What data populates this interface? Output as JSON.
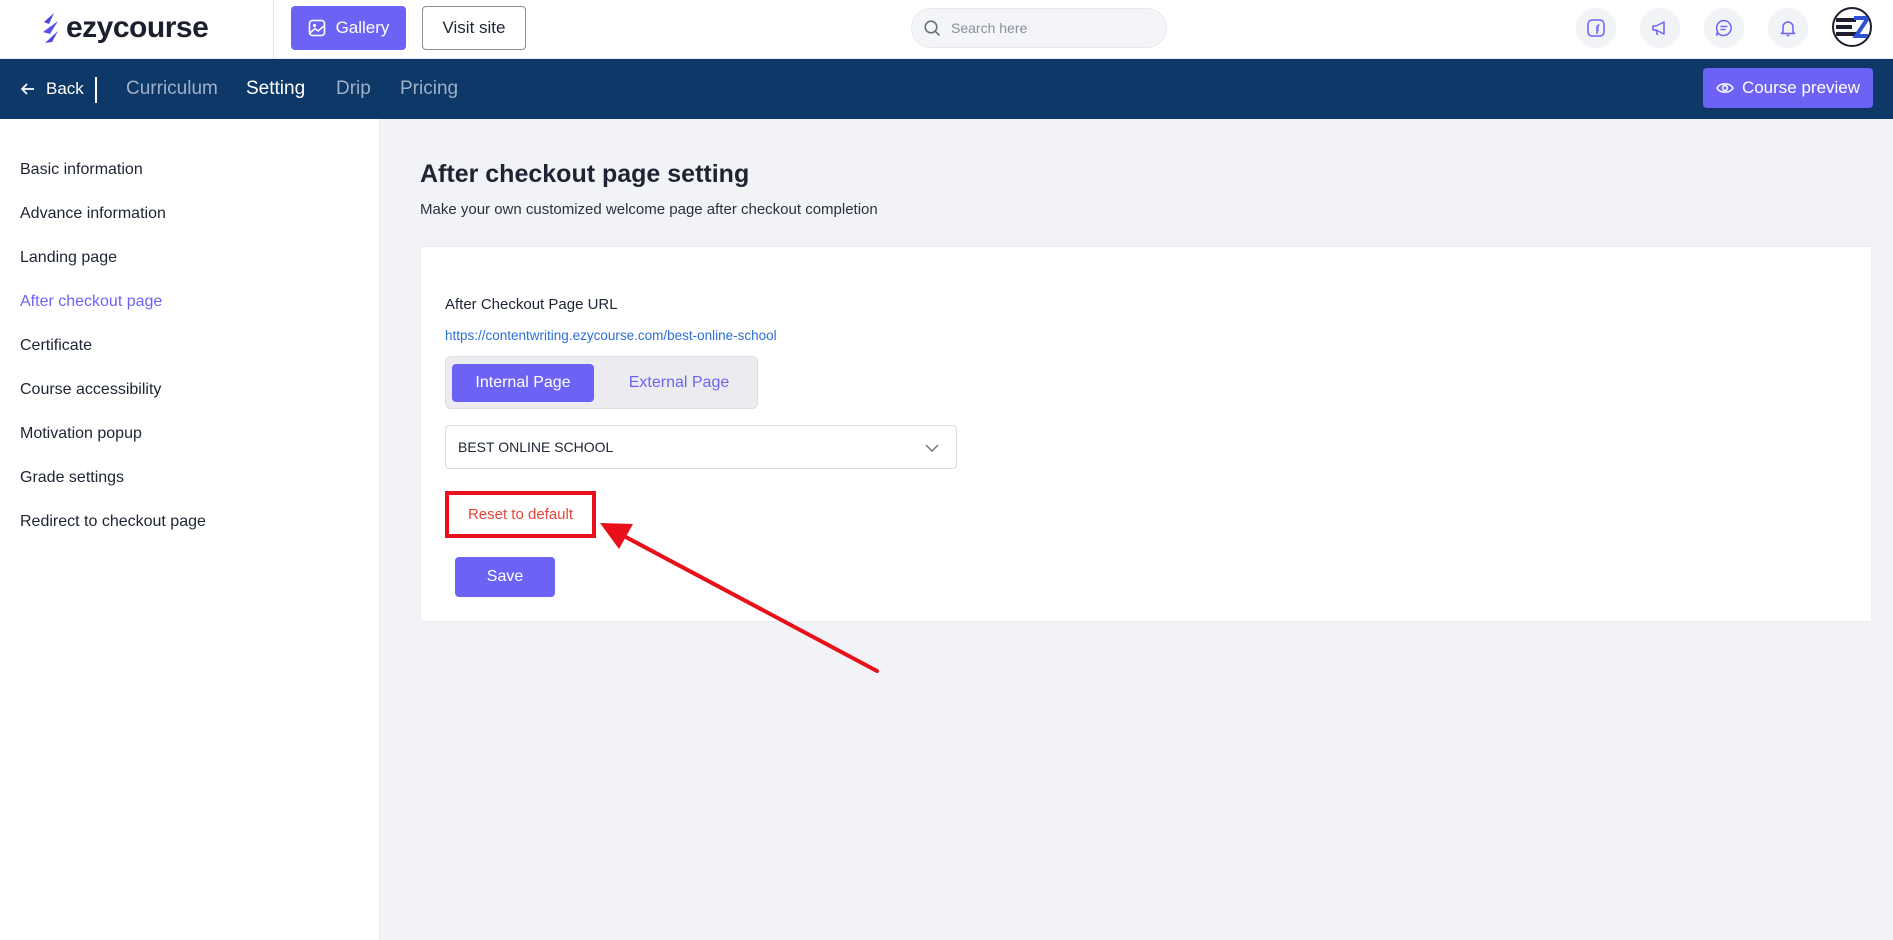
{
  "brand": {
    "name": "ezycourse"
  },
  "topbar": {
    "gallery_label": "Gallery",
    "visit_label": "Visit site",
    "search_placeholder": "Search here",
    "icons": [
      "facebook-icon",
      "megaphone-icon",
      "chat-icon",
      "bell-icon"
    ]
  },
  "nav": {
    "back_label": "Back",
    "tabs": [
      {
        "label": "Curriculum",
        "active": false
      },
      {
        "label": "Setting",
        "active": true
      },
      {
        "label": "Drip",
        "active": false
      },
      {
        "label": "Pricing",
        "active": false
      }
    ],
    "preview_label": "Course preview"
  },
  "sidebar": {
    "items": [
      {
        "label": "Basic information",
        "active": false
      },
      {
        "label": "Advance information",
        "active": false
      },
      {
        "label": "Landing page",
        "active": false
      },
      {
        "label": "After checkout page",
        "active": true
      },
      {
        "label": "Certificate",
        "active": false
      },
      {
        "label": "Course accessibility",
        "active": false
      },
      {
        "label": "Motivation popup",
        "active": false
      },
      {
        "label": "Grade settings",
        "active": false
      },
      {
        "label": "Redirect to checkout page",
        "active": false
      }
    ]
  },
  "main": {
    "title": "After checkout page setting",
    "subtitle": "Make your own customized welcome page after checkout completion",
    "url_label": "After Checkout Page URL",
    "url": "https://contentwriting.ezycourse.com/best-online-school",
    "toggle": {
      "internal_label": "Internal Page",
      "external_label": "External Page",
      "selected": "Internal Page"
    },
    "select_value": "BEST ONLINE SCHOOL",
    "reset_label": "Reset to default",
    "save_label": "Save"
  },
  "colors": {
    "accent": "#6c63f5",
    "navbar": "#0d3868",
    "annotation": "#e8101a",
    "link": "#2c6fd6"
  }
}
